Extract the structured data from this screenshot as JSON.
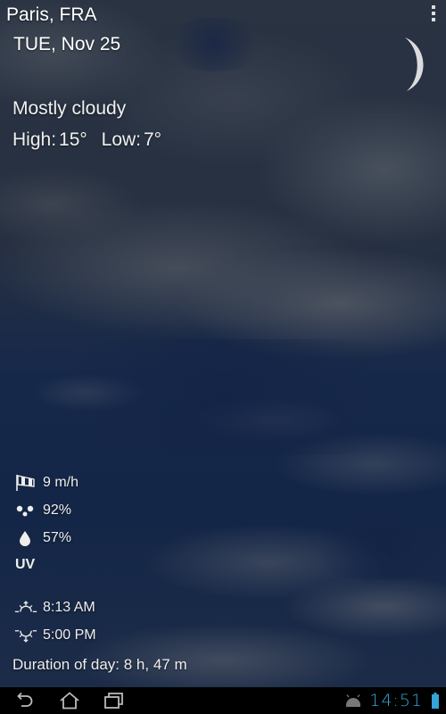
{
  "location": {
    "city": "Paris, FRA",
    "date": "TUE, Nov 25"
  },
  "weather": {
    "condition": "Mostly cloudy",
    "high_label": "High:",
    "high_value": "15°",
    "low_label": "Low:",
    "low_value": "7°",
    "moon_icon": "crescent-moon-icon"
  },
  "details": {
    "wind": {
      "icon": "windsock-icon",
      "value": "9 m/h"
    },
    "precipitation": {
      "icon": "dots-icon",
      "value": "92%"
    },
    "humidity": {
      "icon": "water-drop-icon",
      "value": "57%"
    },
    "uv_label": "UV",
    "sunrise": {
      "icon": "sunrise-icon",
      "value": "8:13 AM"
    },
    "sunset": {
      "icon": "sunset-icon",
      "value": "5:00 PM"
    },
    "duration": "Duration of day: 8 h, 47 m"
  },
  "menu": {
    "icon": "overflow-menu-icon"
  },
  "navbar": {
    "back_icon": "back-icon",
    "home_icon": "home-icon",
    "recents_icon": "recent-apps-icon",
    "notification_icon": "android-icon",
    "clock": "14:51",
    "battery_icon": "battery-icon",
    "accent_color": "#35a4d6"
  }
}
